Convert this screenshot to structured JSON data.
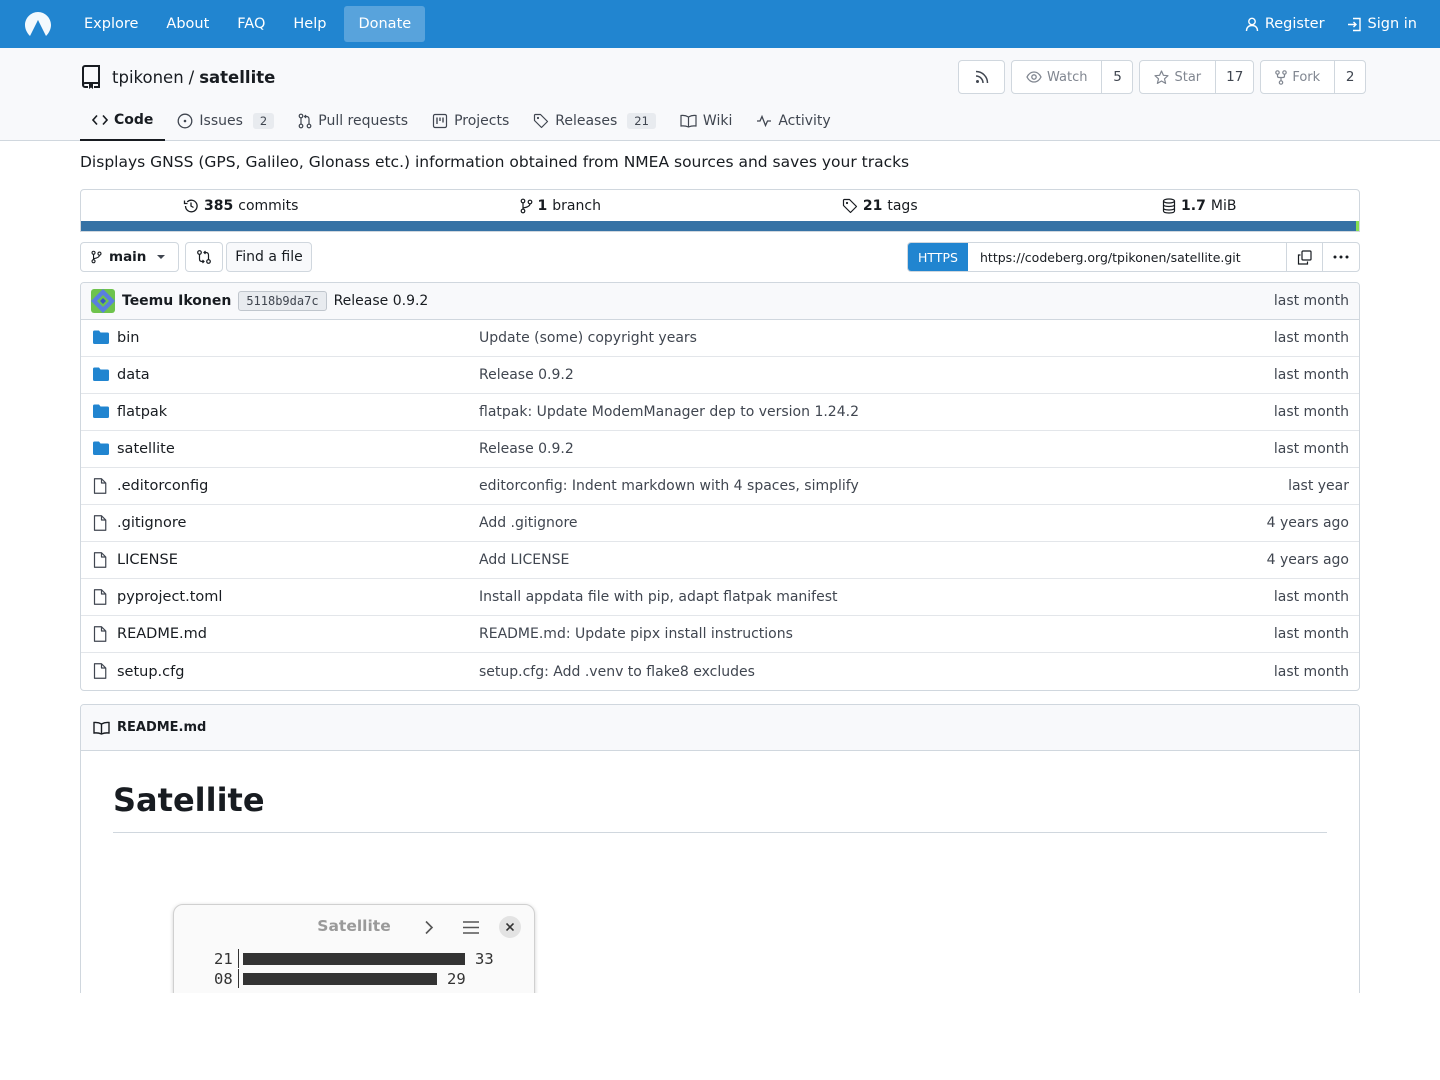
{
  "navbar": {
    "items": [
      "Explore",
      "About",
      "FAQ",
      "Help"
    ],
    "donate": "Donate",
    "register": "Register",
    "sign_in": "Sign in"
  },
  "repo": {
    "owner": "tpikonen",
    "separator": "/",
    "name": "satellite",
    "watch_label": "Watch",
    "watch_count": "5",
    "star_label": "Star",
    "star_count": "17",
    "fork_label": "Fork",
    "fork_count": "2"
  },
  "tabs": [
    {
      "label": "Code"
    },
    {
      "label": "Issues",
      "badge": "2"
    },
    {
      "label": "Pull requests"
    },
    {
      "label": "Projects"
    },
    {
      "label": "Releases",
      "badge": "21"
    },
    {
      "label": "Wiki"
    },
    {
      "label": "Activity"
    }
  ],
  "description": "Displays GNSS (GPS, Galileo, Glonass etc.) information obtained from NMEA sources and saves your tracks",
  "stats": {
    "commits_num": "385",
    "commits_label": "commits",
    "branch_num": "1",
    "branch_label": "branch",
    "tags_num": "21",
    "tags_label": "tags",
    "size_num": "1.7",
    "size_label": "MiB"
  },
  "toolbar": {
    "branch": "main",
    "find_file": "Find a file",
    "clone_protocol": "HTTPS",
    "clone_url": "https://codeberg.org/tpikonen/satellite.git"
  },
  "latest_commit": {
    "author": "Teemu Ikonen",
    "sha": "5118b9da7c",
    "message": "Release 0.9.2",
    "time": "last month"
  },
  "files": [
    {
      "type": "folder",
      "name": "bin",
      "message": "Update (some) copyright years",
      "time": "last month"
    },
    {
      "type": "folder",
      "name": "data",
      "message": "Release 0.9.2",
      "time": "last month"
    },
    {
      "type": "folder",
      "name": "flatpak",
      "message": "flatpak: Update ModemManager dep to version 1.24.2",
      "time": "last month"
    },
    {
      "type": "folder",
      "name": "satellite",
      "message": "Release 0.9.2",
      "time": "last month"
    },
    {
      "type": "file",
      "name": ".editorconfig",
      "message": "editorconfig: Indent markdown with 4 spaces, simplify",
      "time": "last year"
    },
    {
      "type": "file",
      "name": ".gitignore",
      "message": "Add .gitignore",
      "time": "4 years ago"
    },
    {
      "type": "file",
      "name": "LICENSE",
      "message": "Add LICENSE",
      "time": "4 years ago"
    },
    {
      "type": "file",
      "name": "pyproject.toml",
      "message": "Install appdata file with pip, adapt flatpak manifest",
      "time": "last month"
    },
    {
      "type": "file",
      "name": "README.md",
      "message": "README.md: Update pipx install instructions",
      "time": "last month"
    },
    {
      "type": "file",
      "name": "setup.cfg",
      "message": "setup.cfg: Add .venv to flake8 excludes",
      "time": "last month"
    }
  ],
  "readme": {
    "filename": "README.md",
    "heading": "Satellite",
    "screenshot": {
      "title": "Satellite",
      "rows": [
        {
          "prn": "21",
          "snr": "33",
          "level": 33
        },
        {
          "prn": "08",
          "snr": "29",
          "level": 29
        }
      ]
    }
  },
  "colors": {
    "navbar": "#2185d0",
    "lang_python": "#3572a5",
    "lang_other": "#89e051",
    "folder": "#2185d0"
  }
}
